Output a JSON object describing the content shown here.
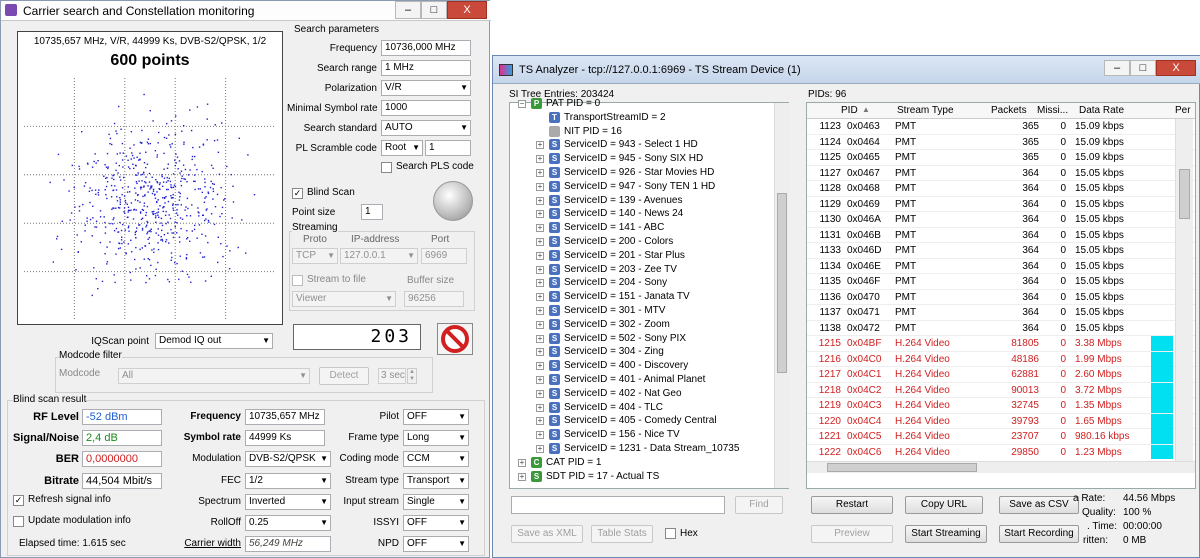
{
  "left_window": {
    "title": "Carrier search and Constellation monitoring",
    "minimize": "–",
    "maximize": "□",
    "close": "X",
    "constellation": {
      "header": "10735,657 MHz, V/R, 44999 Ks, DVB-S2/QPSK, 1/2",
      "points_label": "600 points",
      "points": 600
    },
    "search_params": {
      "group": "Search parameters",
      "frequency_label": "Frequency",
      "frequency": "10736,000 MHz",
      "search_range_label": "Search range",
      "search_range": "1 MHz",
      "polarization_label": "Polarization",
      "polarization": "V/R",
      "min_sr_label": "Minimal Symbol rate",
      "min_sr": "1000",
      "standard_label": "Search standard",
      "standard": "AUTO",
      "pl_scramble_label": "PL Scramble code",
      "pl_mode": "Root",
      "pl_code": "1",
      "search_pls": "Search PLS code"
    },
    "blind": {
      "label": "Blind Scan",
      "point_size_label": "Point size",
      "point_size": "1"
    },
    "streaming": {
      "group": "Streaming",
      "proto_h": "Proto",
      "ip_h": "IP-address",
      "port_h": "Port",
      "proto": "TCP",
      "ip": "127.0.0.1",
      "port": "6969",
      "stream_to_file": "Stream to file",
      "buffer_label": "Buffer size",
      "viewer": "Viewer",
      "buffer": "96256"
    },
    "counter": "203",
    "iq": {
      "label": "IQScan point",
      "value": "Demod IQ out"
    },
    "modcode": {
      "group": "Modcode filter",
      "label": "Modcode",
      "value": "All",
      "detect": "Detect",
      "sec": "3 sec"
    },
    "result": {
      "group": "Blind scan result",
      "rf_label": "RF Level",
      "rf": "-52 dBm",
      "sn_label": "Signal/Noise",
      "sn": "2,4 dB",
      "ber_label": "BER",
      "ber": "0,0000000",
      "bitrate_label": "Bitrate",
      "bitrate": "44,504 Mbit/s",
      "refresh": "Refresh signal info",
      "update": "Update modulation info",
      "elapsed": "Elapsed time: 1.615 sec",
      "freq_label": "Frequency",
      "freq": "10735,657 MHz",
      "sr_label": "Symbol rate",
      "sr": "44999 Ks",
      "mod_label": "Modulation",
      "mod": "DVB-S2/QPSK",
      "fec_label": "FEC",
      "fec": "1/2",
      "spec_label": "Spectrum",
      "spec": "Inverted",
      "roll_label": "RollOff",
      "roll": "0.25",
      "cw_label": "Carrier width",
      "cw": "56,249 MHz",
      "pilot_label": "Pilot",
      "pilot": "OFF",
      "frame_label": "Frame type",
      "frame": "Long",
      "coding_label": "Coding mode",
      "coding": "CCM",
      "stype_label": "Stream type",
      "stype": "Transport",
      "input_label": "Input stream",
      "input": "Single",
      "issyi_label": "ISSYI",
      "issyi": "OFF",
      "npd_label": "NPD",
      "npd": "OFF"
    }
  },
  "right_window": {
    "title": "TS Analyzer - tcp://127.0.0.1:6969 - TS Stream Device (1)",
    "si_label": "SI Tree Entries: 203424",
    "pids_label": "PIDs: 96",
    "tree": [
      {
        "icon": "P",
        "color": "#3a9a3a",
        "text": "PAT PID = 0",
        "lvl": 0,
        "exp": "−"
      },
      {
        "icon": "T",
        "color": "#4a70c0",
        "text": "TransportStreamID = 2",
        "lvl": 1,
        "exp": ""
      },
      {
        "icon": "",
        "color": "#aaaaaa",
        "text": "NIT PID = 16",
        "lvl": 1,
        "exp": ""
      },
      {
        "icon": "S",
        "color": "#4a70c0",
        "text": "ServiceID = 943 - Select 1 HD",
        "lvl": 1,
        "exp": "+"
      },
      {
        "icon": "S",
        "color": "#4a70c0",
        "text": "ServiceID = 945 - Sony SIX HD",
        "lvl": 1,
        "exp": "+"
      },
      {
        "icon": "S",
        "color": "#4a70c0",
        "text": "ServiceID = 926 - Star Movies HD",
        "lvl": 1,
        "exp": "+"
      },
      {
        "icon": "S",
        "color": "#4a70c0",
        "text": "ServiceID = 947 - Sony TEN 1 HD",
        "lvl": 1,
        "exp": "+"
      },
      {
        "icon": "S",
        "color": "#4a70c0",
        "text": "ServiceID = 139 - Avenues",
        "lvl": 1,
        "exp": "+"
      },
      {
        "icon": "S",
        "color": "#4a70c0",
        "text": "ServiceID = 140 - News 24",
        "lvl": 1,
        "exp": "+"
      },
      {
        "icon": "S",
        "color": "#4a70c0",
        "text": "ServiceID = 141 - ABC",
        "lvl": 1,
        "exp": "+"
      },
      {
        "icon": "S",
        "color": "#4a70c0",
        "text": "ServiceID = 200 - Colors",
        "lvl": 1,
        "exp": "+"
      },
      {
        "icon": "S",
        "color": "#4a70c0",
        "text": "ServiceID = 201 - Star Plus",
        "lvl": 1,
        "exp": "+"
      },
      {
        "icon": "S",
        "color": "#4a70c0",
        "text": "ServiceID = 203 - Zee TV",
        "lvl": 1,
        "exp": "+"
      },
      {
        "icon": "S",
        "color": "#4a70c0",
        "text": "ServiceID = 204 - Sony",
        "lvl": 1,
        "exp": "+"
      },
      {
        "icon": "S",
        "color": "#4a70c0",
        "text": "ServiceID = 151 - Janata TV",
        "lvl": 1,
        "exp": "+"
      },
      {
        "icon": "S",
        "color": "#4a70c0",
        "text": "ServiceID = 301 - MTV",
        "lvl": 1,
        "exp": "+"
      },
      {
        "icon": "S",
        "color": "#4a70c0",
        "text": "ServiceID = 302 - Zoom",
        "lvl": 1,
        "exp": "+"
      },
      {
        "icon": "S",
        "color": "#4a70c0",
        "text": "ServiceID = 502 - Sony PIX",
        "lvl": 1,
        "exp": "+"
      },
      {
        "icon": "S",
        "color": "#4a70c0",
        "text": "ServiceID = 304 - Zing",
        "lvl": 1,
        "exp": "+"
      },
      {
        "icon": "S",
        "color": "#4a70c0",
        "text": "ServiceID = 400 - Discovery",
        "lvl": 1,
        "exp": "+"
      },
      {
        "icon": "S",
        "color": "#4a70c0",
        "text": "ServiceID = 401 - Animal Planet",
        "lvl": 1,
        "exp": "+"
      },
      {
        "icon": "S",
        "color": "#4a70c0",
        "text": "ServiceID = 402 - Nat Geo",
        "lvl": 1,
        "exp": "+"
      },
      {
        "icon": "S",
        "color": "#4a70c0",
        "text": "ServiceID = 404 - TLC",
        "lvl": 1,
        "exp": "+"
      },
      {
        "icon": "S",
        "color": "#4a70c0",
        "text": "ServiceID = 405 - Comedy Central",
        "lvl": 1,
        "exp": "+"
      },
      {
        "icon": "S",
        "color": "#4a70c0",
        "text": "ServiceID = 156 - Nice TV",
        "lvl": 1,
        "exp": "+"
      },
      {
        "icon": "S",
        "color": "#4a70c0",
        "text": "ServiceID = 1231 - Data Stream_10735",
        "lvl": 1,
        "exp": "+"
      },
      {
        "icon": "C",
        "color": "#3a9a3a",
        "text": "CAT PID = 1",
        "lvl": 0,
        "exp": "+"
      },
      {
        "icon": "S",
        "color": "#3a9a3a",
        "text": "SDT PID = 17 - Actual TS",
        "lvl": 0,
        "exp": "+"
      }
    ],
    "columns": [
      "PID",
      "Stream Type",
      "Packets",
      "Missi...",
      "Data Rate",
      "Per"
    ],
    "rows": [
      [
        "1123",
        "0x0463",
        "PMT",
        "365",
        "0",
        "15.09 kbps",
        0
      ],
      [
        "1124",
        "0x0464",
        "PMT",
        "365",
        "0",
        "15.09 kbps",
        0
      ],
      [
        "1125",
        "0x0465",
        "PMT",
        "365",
        "0",
        "15.09 kbps",
        0
      ],
      [
        "1127",
        "0x0467",
        "PMT",
        "364",
        "0",
        "15.05 kbps",
        0
      ],
      [
        "1128",
        "0x0468",
        "PMT",
        "364",
        "0",
        "15.05 kbps",
        0
      ],
      [
        "1129",
        "0x0469",
        "PMT",
        "364",
        "0",
        "15.05 kbps",
        0
      ],
      [
        "1130",
        "0x046A",
        "PMT",
        "364",
        "0",
        "15.05 kbps",
        0
      ],
      [
        "1131",
        "0x046B",
        "PMT",
        "364",
        "0",
        "15.05 kbps",
        0
      ],
      [
        "1133",
        "0x046D",
        "PMT",
        "364",
        "0",
        "15.05 kbps",
        0
      ],
      [
        "1134",
        "0x046E",
        "PMT",
        "364",
        "0",
        "15.05 kbps",
        0
      ],
      [
        "1135",
        "0x046F",
        "PMT",
        "364",
        "0",
        "15.05 kbps",
        0
      ],
      [
        "1136",
        "0x0470",
        "PMT",
        "364",
        "0",
        "15.05 kbps",
        0
      ],
      [
        "1137",
        "0x0471",
        "PMT",
        "364",
        "0",
        "15.05 kbps",
        0
      ],
      [
        "1138",
        "0x0472",
        "PMT",
        "364",
        "0",
        "15.05 kbps",
        0
      ],
      [
        "1215",
        "0x04BF",
        "H.264 Video",
        "81805",
        "0",
        "3.38 Mbps",
        1
      ],
      [
        "1216",
        "0x04C0",
        "H.264 Video",
        "48186",
        "0",
        "1.99 Mbps",
        1
      ],
      [
        "1217",
        "0x04C1",
        "H.264 Video",
        "62881",
        "0",
        "2.60 Mbps",
        1
      ],
      [
        "1218",
        "0x04C2",
        "H.264 Video",
        "90013",
        "0",
        "3.72 Mbps",
        1
      ],
      [
        "1219",
        "0x04C3",
        "H.264 Video",
        "32745",
        "0",
        "1.35 Mbps",
        1
      ],
      [
        "1220",
        "0x04C4",
        "H.264 Video",
        "39793",
        "0",
        "1.65 Mbps",
        1
      ],
      [
        "1221",
        "0x04C5",
        "H.264 Video",
        "23707",
        "0",
        "980.16 kbps",
        1
      ],
      [
        "1222",
        "0x04C6",
        "H.264 Video",
        "29850",
        "0",
        "1.23 Mbps",
        1
      ]
    ],
    "find": "Find",
    "save_xml": "Save as XML",
    "table_stats": "Table Stats",
    "hex": "Hex",
    "restart": "Restart",
    "copy_url": "Copy URL",
    "save_csv": "Save as CSV",
    "preview": "Preview",
    "start_streaming": "Start Streaming",
    "start_recording": "Start Recording",
    "stats": [
      {
        "l": "a Rate:",
        "v": "44.56 Mbps"
      },
      {
        "l": "Quality:",
        "v": "100 %"
      },
      {
        "l": ". Time:",
        "v": "00:00:00"
      },
      {
        "l": "ritten:",
        "v": "0 MB"
      }
    ]
  }
}
